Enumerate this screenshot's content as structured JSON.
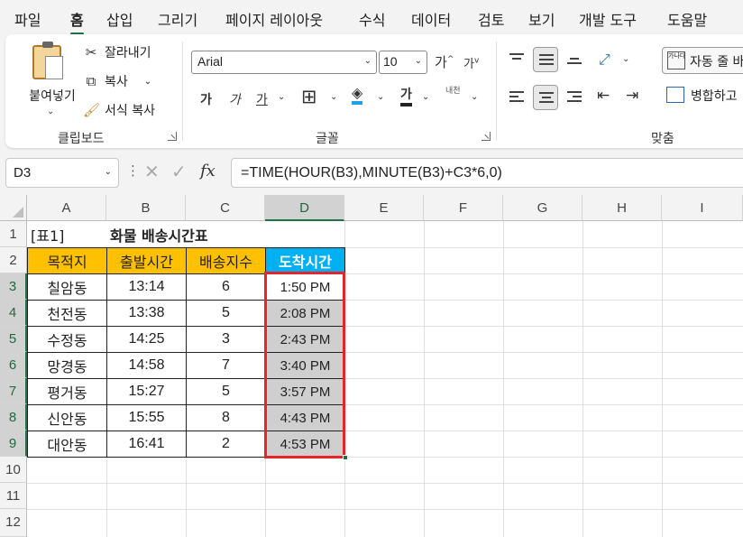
{
  "menu": {
    "tabs": [
      "파일",
      "홈",
      "삽입",
      "그리기",
      "페이지 레이아웃",
      "수식",
      "데이터",
      "검토",
      "보기",
      "개발 도구",
      "도움말"
    ],
    "active": "홈"
  },
  "ribbon": {
    "clipboard": {
      "paste_label": "붙여넣기",
      "cut_label": "잘라내기",
      "copy_label": "복사",
      "format_painter_label": "서식 복사",
      "group_label": "클립보드"
    },
    "font": {
      "font_name": "Arial",
      "font_size": "10",
      "grow_label": "가",
      "shrink_label": "가",
      "bold_label": "가",
      "italic_label": "가",
      "underline_label": "가",
      "bold2_label": "가",
      "phonetic_label": "내천",
      "group_label": "글꼴"
    },
    "alignment": {
      "wrap_label": "자동 줄 바",
      "wrap_icon_text": "가나다",
      "merge_label": "병합하고",
      "group_label": "맞춤"
    }
  },
  "formula_bar": {
    "name_box": "D3",
    "fx_label": "fx",
    "formula": "=TIME(HOUR(B3),MINUTE(B3)+C3*6,0)"
  },
  "sheet": {
    "columns": [
      "A",
      "B",
      "C",
      "D",
      "E",
      "F",
      "G",
      "H",
      "I"
    ],
    "rows": [
      "1",
      "2",
      "3",
      "4",
      "5",
      "6",
      "7",
      "8",
      "9",
      "10",
      "11",
      "12"
    ],
    "selected_column": "D",
    "selected_rows": [
      "3",
      "4",
      "5",
      "6",
      "7",
      "8",
      "9"
    ],
    "cells": {
      "A1": "[표1]",
      "B1": "화물 배송시간표",
      "headers": [
        "목적지",
        "출발시간",
        "배송지수",
        "도착시간"
      ],
      "data": [
        [
          "칠암동",
          "13:14",
          "6",
          "1:50 PM"
        ],
        [
          "천전동",
          "13:38",
          "5",
          "2:08 PM"
        ],
        [
          "수정동",
          "14:25",
          "3",
          "2:43 PM"
        ],
        [
          "망경동",
          "14:58",
          "7",
          "3:40 PM"
        ],
        [
          "평거동",
          "15:27",
          "5",
          "3:57 PM"
        ],
        [
          "신안동",
          "15:55",
          "8",
          "4:43 PM"
        ],
        [
          "대안동",
          "16:41",
          "2",
          "4:53 PM"
        ]
      ]
    },
    "colors": {
      "header_orange": "#ffc000",
      "header_blue": "#00b0f0",
      "selection_red": "#e8242b",
      "excel_green": "#217346"
    }
  }
}
